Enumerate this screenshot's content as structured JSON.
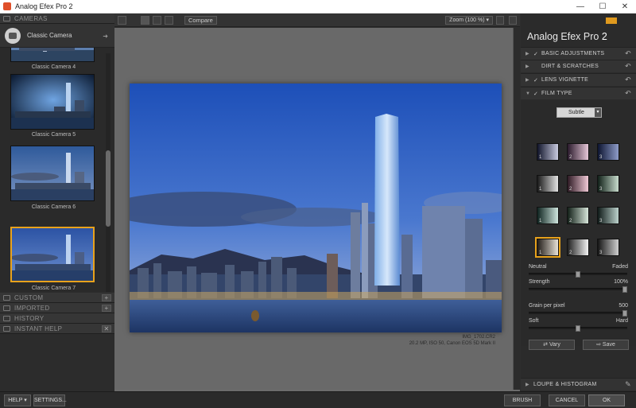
{
  "window": {
    "title": "Analog Efex Pro 2",
    "minimize": "—",
    "maximize": "☐",
    "close": "✕"
  },
  "left_panel": {
    "header": "CAMERAS",
    "preset_name": "Classic Camera",
    "thumbnails": [
      {
        "label": "Classic Camera 4"
      },
      {
        "label": "Classic Camera 5"
      },
      {
        "label": "Classic Camera 6"
      },
      {
        "label": "Classic Camera 7",
        "selected": true
      }
    ],
    "sections": [
      "CUSTOM",
      "IMPORTED",
      "HISTORY",
      "INSTANT HELP"
    ]
  },
  "toolbar": {
    "compare_label": "Compare",
    "zoom_label": "Zoom (100 %)"
  },
  "image": {
    "filename": "IMG_1702.CR2",
    "meta": "20.2 MP, ISO 50, Canon EOS 5D Mark II"
  },
  "right_panel": {
    "brand": "Analog Efex Pro",
    "brand_version": "2",
    "sections": [
      {
        "label": "BASIC ADJUSTMENTS",
        "checked": true
      },
      {
        "label": "DIRT & SCRATCHES",
        "checked": false
      },
      {
        "label": "LENS VIGNETTE",
        "checked": true
      },
      {
        "label": "FILM TYPE",
        "checked": true,
        "expanded": true
      }
    ],
    "film_type": {
      "dropdown": "Subtle",
      "swatches": [
        {
          "n": "1"
        },
        {
          "n": "2"
        },
        {
          "n": "3"
        },
        {
          "n": "1"
        },
        {
          "n": "2"
        },
        {
          "n": "3"
        },
        {
          "n": "1"
        },
        {
          "n": "2"
        },
        {
          "n": "3"
        },
        {
          "n": "1",
          "selected": true
        },
        {
          "n": "2"
        },
        {
          "n": "3"
        }
      ],
      "neutral_label": "Neutral",
      "faded_label": "Faded",
      "neutral_faded_value": 0.5,
      "strength_label": "Strength",
      "strength_value": "100%",
      "grain_label": "Grain per pixel",
      "grain_value": "500",
      "soft_label": "Soft",
      "hard_label": "Hard",
      "soft_hard_value": 0.5,
      "vary_label": "Vary",
      "save_label": "Save"
    },
    "loupe_label": "LOUPE & HISTOGRAM"
  },
  "bottom_bar": {
    "help": "HELP ▾",
    "settings": "SETTINGS...",
    "brush": "BRUSH",
    "cancel": "CANCEL",
    "ok": "OK"
  },
  "colors": {
    "accent": "#e8a21c",
    "panel": "#2c2c2c",
    "canvas": "#6b6b6b"
  }
}
